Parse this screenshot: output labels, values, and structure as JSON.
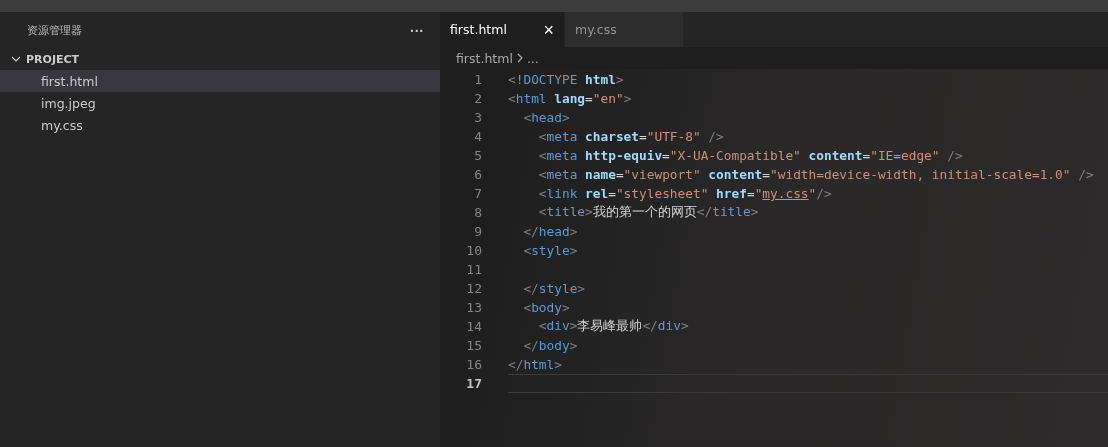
{
  "sidebar": {
    "title": "资源管理器",
    "more": "···",
    "folder": {
      "name": "PROJECT",
      "expanded": true,
      "files": [
        {
          "name": "first.html",
          "selected": true
        },
        {
          "name": "img.jpeg",
          "selected": false
        },
        {
          "name": "my.css",
          "selected": false
        }
      ]
    }
  },
  "tabs": [
    {
      "label": "first.html",
      "selected": true,
      "close": "×"
    },
    {
      "label": "my.css",
      "selected": false
    }
  ],
  "breadcrumb": [
    "first.html",
    "..."
  ],
  "code": [
    {
      "number": "1",
      "current": false,
      "tokens": [
        {
          "kind": "punct",
          "text": "<"
        },
        {
          "kind": "tag",
          "text": "!DOCTYPE "
        },
        {
          "kind": "attr",
          "text": "html"
        },
        {
          "kind": "punct",
          "text": ">"
        }
      ]
    },
    {
      "number": "2",
      "current": false,
      "tokens": [
        {
          "kind": "punct",
          "text": "<"
        },
        {
          "kind": "tag",
          "text": "html "
        },
        {
          "kind": "attr",
          "text": "lang"
        },
        {
          "kind": "text",
          "text": "="
        },
        {
          "kind": "str",
          "text": "\"en\""
        },
        {
          "kind": "punct",
          "text": ">"
        }
      ]
    },
    {
      "number": "3",
      "current": false,
      "tokens": [
        {
          "kind": "punct",
          "text": "  <"
        },
        {
          "kind": "tag",
          "text": "head"
        },
        {
          "kind": "punct",
          "text": ">"
        }
      ]
    },
    {
      "number": "4",
      "current": false,
      "tokens": [
        {
          "kind": "punct",
          "text": "    <"
        },
        {
          "kind": "tag",
          "text": "meta "
        },
        {
          "kind": "attr",
          "text": "charset"
        },
        {
          "kind": "text",
          "text": "="
        },
        {
          "kind": "str",
          "text": "\"UTF-8\""
        },
        {
          "kind": "punct",
          "text": " />"
        }
      ]
    },
    {
      "number": "5",
      "current": false,
      "tokens": [
        {
          "kind": "punct",
          "text": "    <"
        },
        {
          "kind": "tag",
          "text": "meta "
        },
        {
          "kind": "attr",
          "text": "http-equiv"
        },
        {
          "kind": "text",
          "text": "="
        },
        {
          "kind": "str",
          "text": "\"X-UA-Compatible\" "
        },
        {
          "kind": "attr",
          "text": "content"
        },
        {
          "kind": "text",
          "text": "="
        },
        {
          "kind": "str",
          "text": "\"IE=edge\""
        },
        {
          "kind": "punct",
          "text": " />"
        }
      ]
    },
    {
      "number": "6",
      "current": false,
      "tokens": [
        {
          "kind": "punct",
          "text": "    <"
        },
        {
          "kind": "tag",
          "text": "meta "
        },
        {
          "kind": "attr",
          "text": "name"
        },
        {
          "kind": "text",
          "text": "="
        },
        {
          "kind": "str",
          "text": "\"viewport\" "
        },
        {
          "kind": "attr",
          "text": "content"
        },
        {
          "kind": "text",
          "text": "="
        },
        {
          "kind": "str",
          "text": "\"width=device-width, initial-scale=1.0\""
        },
        {
          "kind": "punct",
          "text": " />"
        }
      ]
    },
    {
      "number": "7",
      "current": false,
      "tokens": [
        {
          "kind": "punct",
          "text": "    <"
        },
        {
          "kind": "tag",
          "text": "link "
        },
        {
          "kind": "attr",
          "text": "rel"
        },
        {
          "kind": "text",
          "text": "="
        },
        {
          "kind": "str",
          "text": "\"stylesheet\" "
        },
        {
          "kind": "attr",
          "text": "href"
        },
        {
          "kind": "text",
          "text": "="
        },
        {
          "kind": "str",
          "text": "\""
        },
        {
          "kind": "link",
          "text": "my.css"
        },
        {
          "kind": "str",
          "text": "\""
        },
        {
          "kind": "punct",
          "text": "/>"
        }
      ]
    },
    {
      "number": "8",
      "current": false,
      "tokens": [
        {
          "kind": "punct",
          "text": "    <"
        },
        {
          "kind": "tag",
          "text": "title"
        },
        {
          "kind": "punct",
          "text": ">"
        },
        {
          "kind": "text",
          "text": "我的第一个的网页"
        },
        {
          "kind": "punct",
          "text": "</"
        },
        {
          "kind": "tag",
          "text": "title"
        },
        {
          "kind": "punct",
          "text": ">"
        }
      ]
    },
    {
      "number": "9",
      "current": false,
      "tokens": [
        {
          "kind": "punct",
          "text": "  </"
        },
        {
          "kind": "tag",
          "text": "head"
        },
        {
          "kind": "punct",
          "text": ">"
        }
      ]
    },
    {
      "number": "10",
      "current": false,
      "tokens": [
        {
          "kind": "punct",
          "text": "  <"
        },
        {
          "kind": "tag",
          "text": "style"
        },
        {
          "kind": "punct",
          "text": ">"
        }
      ]
    },
    {
      "number": "11",
      "current": false
    },
    {
      "number": "12",
      "current": false,
      "tokens": [
        {
          "kind": "punct",
          "text": "  </"
        },
        {
          "kind": "tag",
          "text": "style"
        },
        {
          "kind": "punct",
          "text": ">"
        }
      ]
    },
    {
      "number": "13",
      "current": false,
      "tokens": [
        {
          "kind": "punct",
          "text": "  <"
        },
        {
          "kind": "tag",
          "text": "body"
        },
        {
          "kind": "punct",
          "text": ">"
        }
      ]
    },
    {
      "number": "14",
      "current": false,
      "tokens": [
        {
          "kind": "punct",
          "text": "    <"
        },
        {
          "kind": "tag",
          "text": "div"
        },
        {
          "kind": "punct",
          "text": ">"
        },
        {
          "kind": "text",
          "text": "李易峰最帅"
        },
        {
          "kind": "punct",
          "text": "</"
        },
        {
          "kind": "tag",
          "text": "div"
        },
        {
          "kind": "punct",
          "text": ">"
        }
      ]
    },
    {
      "number": "15",
      "current": false,
      "tokens": [
        {
          "kind": "punct",
          "text": "  </"
        },
        {
          "kind": "tag",
          "text": "body"
        },
        {
          "kind": "punct",
          "text": ">"
        }
      ]
    },
    {
      "number": "16",
      "current": false,
      "tokens": [
        {
          "kind": "punct",
          "text": "</"
        },
        {
          "kind": "tag",
          "text": "html"
        },
        {
          "kind": "punct",
          "text": ">"
        }
      ]
    },
    {
      "number": "17",
      "current": true
    }
  ]
}
